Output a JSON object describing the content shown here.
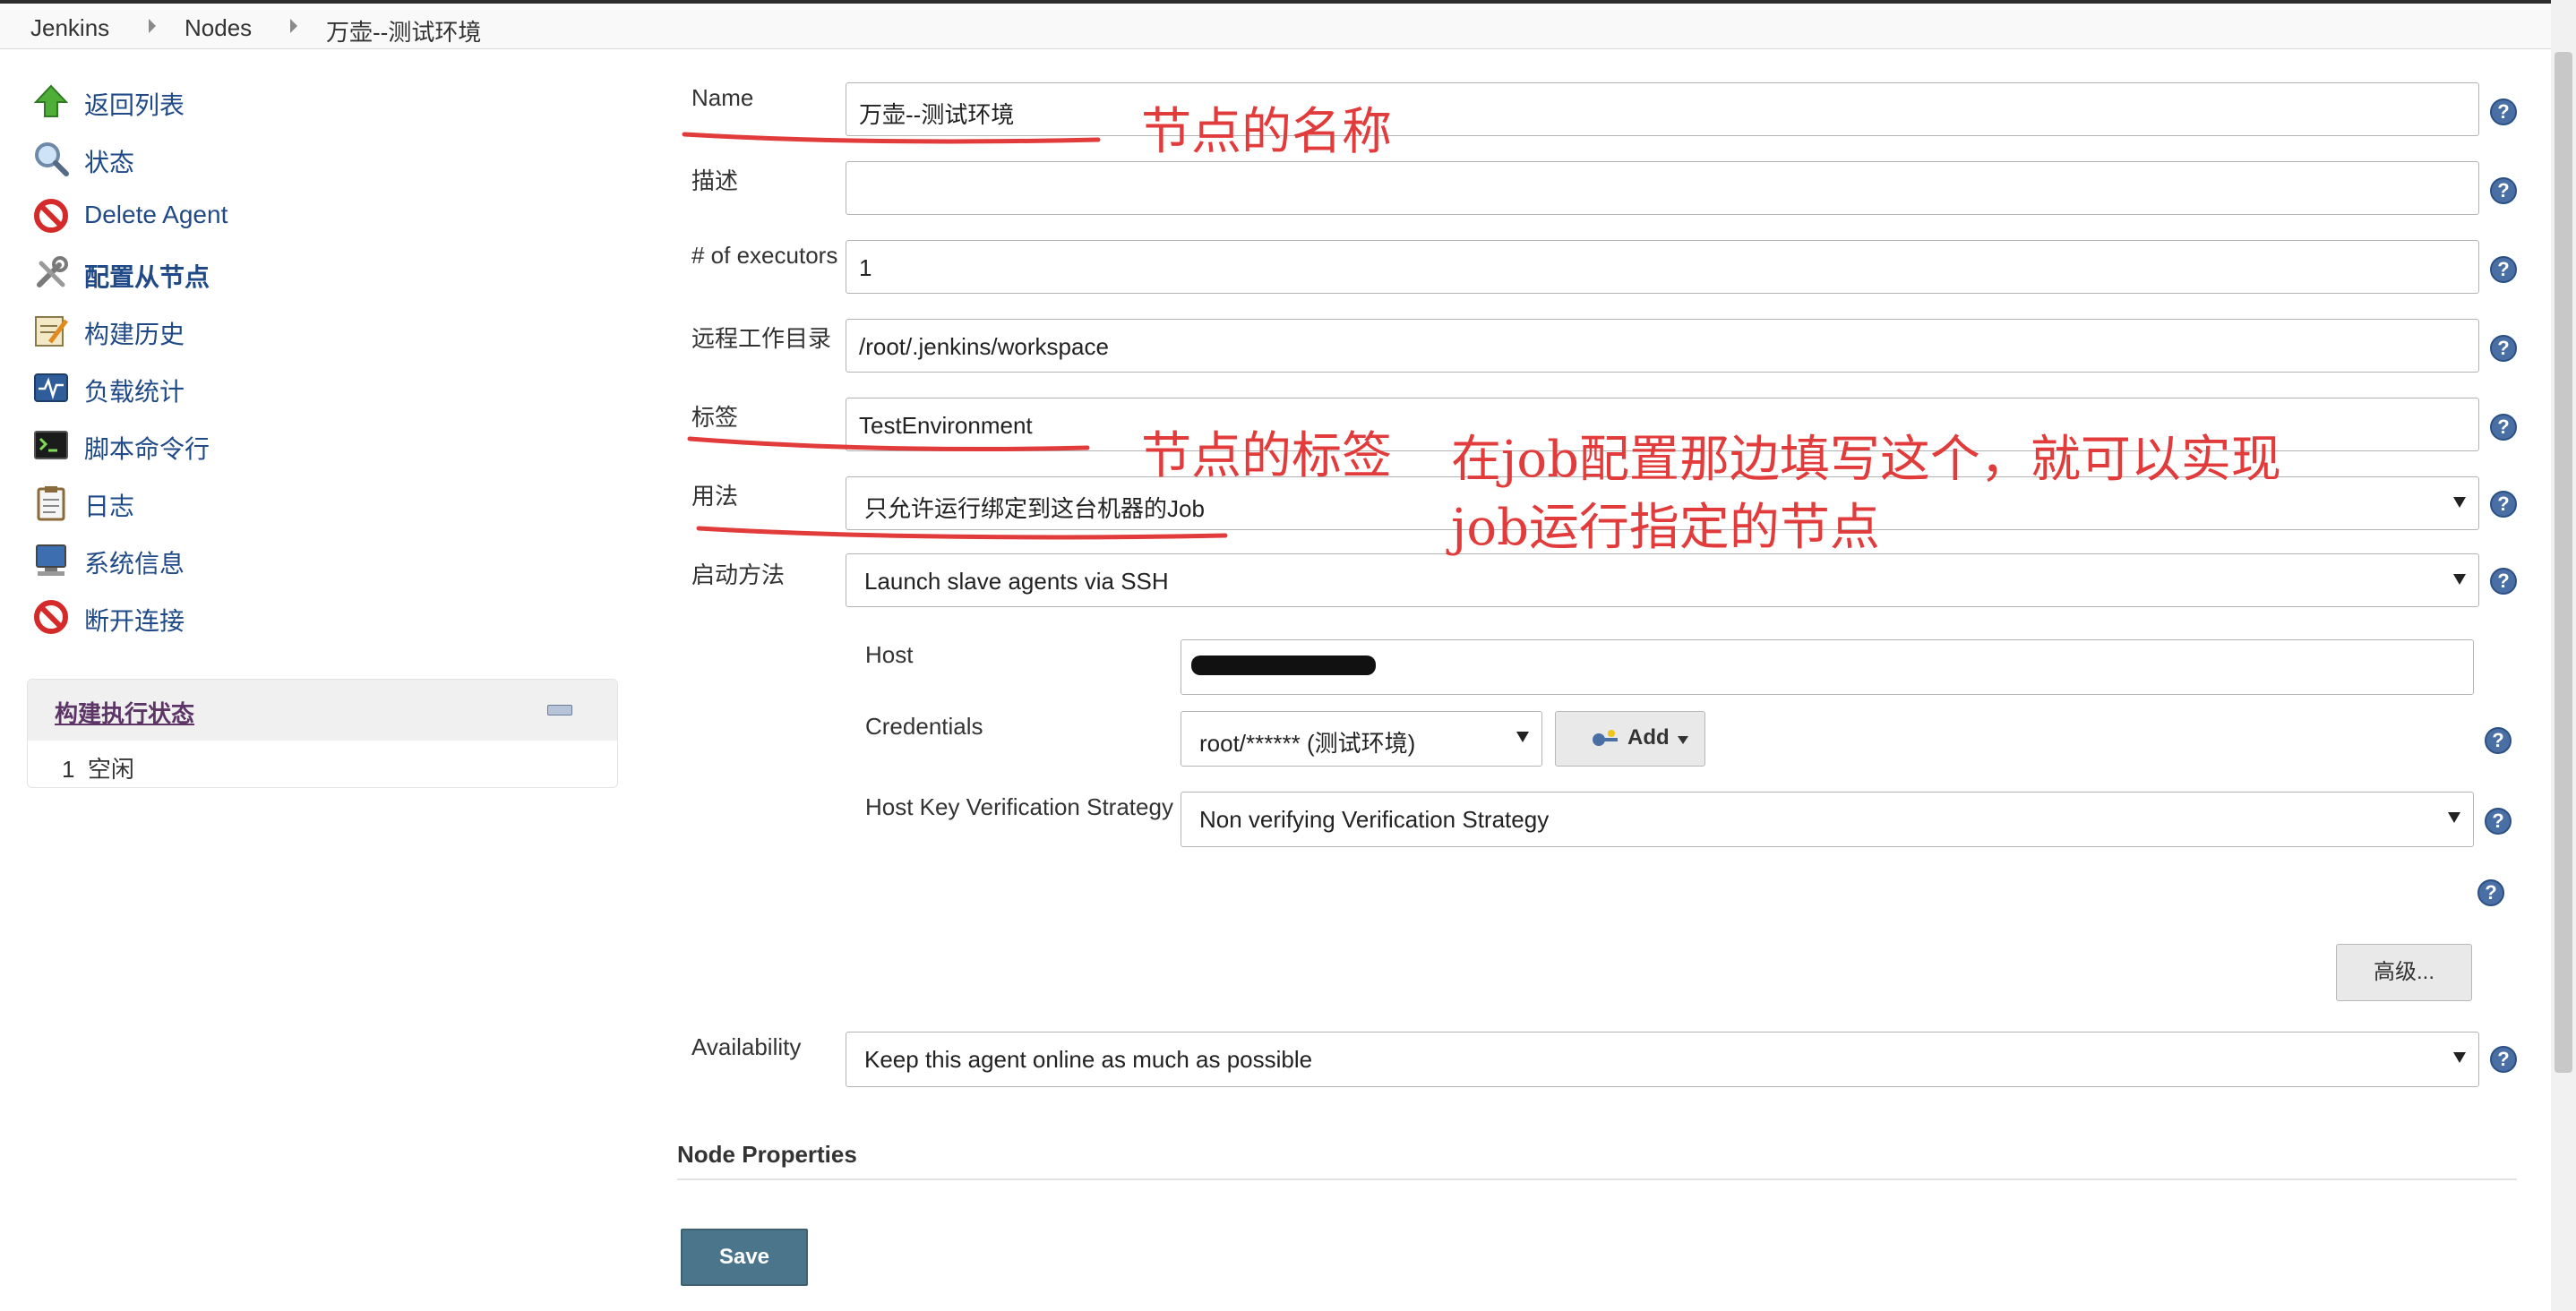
{
  "breadcrumb": {
    "items": [
      "Jenkins",
      "Nodes",
      "万壶--测试环境"
    ]
  },
  "sidebar": {
    "items": [
      {
        "label": "返回列表",
        "icon": "up-arrow-icon"
      },
      {
        "label": "状态",
        "icon": "magnifier-icon"
      },
      {
        "label": "Delete Agent",
        "icon": "no-entry-icon"
      },
      {
        "label": "配置从节点",
        "icon": "wrench-icon",
        "active": true
      },
      {
        "label": "构建历史",
        "icon": "notepad-icon"
      },
      {
        "label": "负载统计",
        "icon": "monitor-graph-icon"
      },
      {
        "label": "脚本命令行",
        "icon": "terminal-icon"
      },
      {
        "label": "日志",
        "icon": "clipboard-icon"
      },
      {
        "label": "系统信息",
        "icon": "computer-icon"
      },
      {
        "label": "断开连接",
        "icon": "no-entry-icon"
      }
    ],
    "executor": {
      "title": "构建执行状态",
      "row_number": "1",
      "row_status": "空闲"
    }
  },
  "form": {
    "name": {
      "label": "Name",
      "value": "万壶--测试环境"
    },
    "description": {
      "label": "描述",
      "value": ""
    },
    "executors": {
      "label": "# of executors",
      "value": "1"
    },
    "remote_dir": {
      "label": "远程工作目录",
      "value": "/root/.jenkins/workspace"
    },
    "labels": {
      "label": "标签",
      "value": "TestEnvironment"
    },
    "usage": {
      "label": "用法",
      "value": "只允许运行绑定到这台机器的Job"
    },
    "launch": {
      "label": "启动方法",
      "value": "Launch slave agents via SSH"
    },
    "host": {
      "label": "Host",
      "value": ""
    },
    "credentials": {
      "label": "Credentials",
      "value": "root/****** (测试环境)",
      "add_label": "Add"
    },
    "host_key": {
      "label": "Host Key Verification Strategy",
      "value": "Non verifying Verification Strategy"
    },
    "advanced_label": "高级...",
    "availability": {
      "label": "Availability",
      "value": "Keep this agent online as much as possible"
    },
    "node_properties_title": "Node Properties",
    "save_label": "Save",
    "help_glyph": "?"
  },
  "annotations": {
    "name_note": "节点的名称",
    "label_note": "节点的标签",
    "job_note_line1": "在job配置那边填写这个，就可以实现",
    "job_note_line2": "job运行指定的节点",
    "color": "#e23b3b"
  },
  "colors": {
    "link": "#204a87",
    "save_button": "#4b758b",
    "help_icon": "#4a6fa5"
  }
}
